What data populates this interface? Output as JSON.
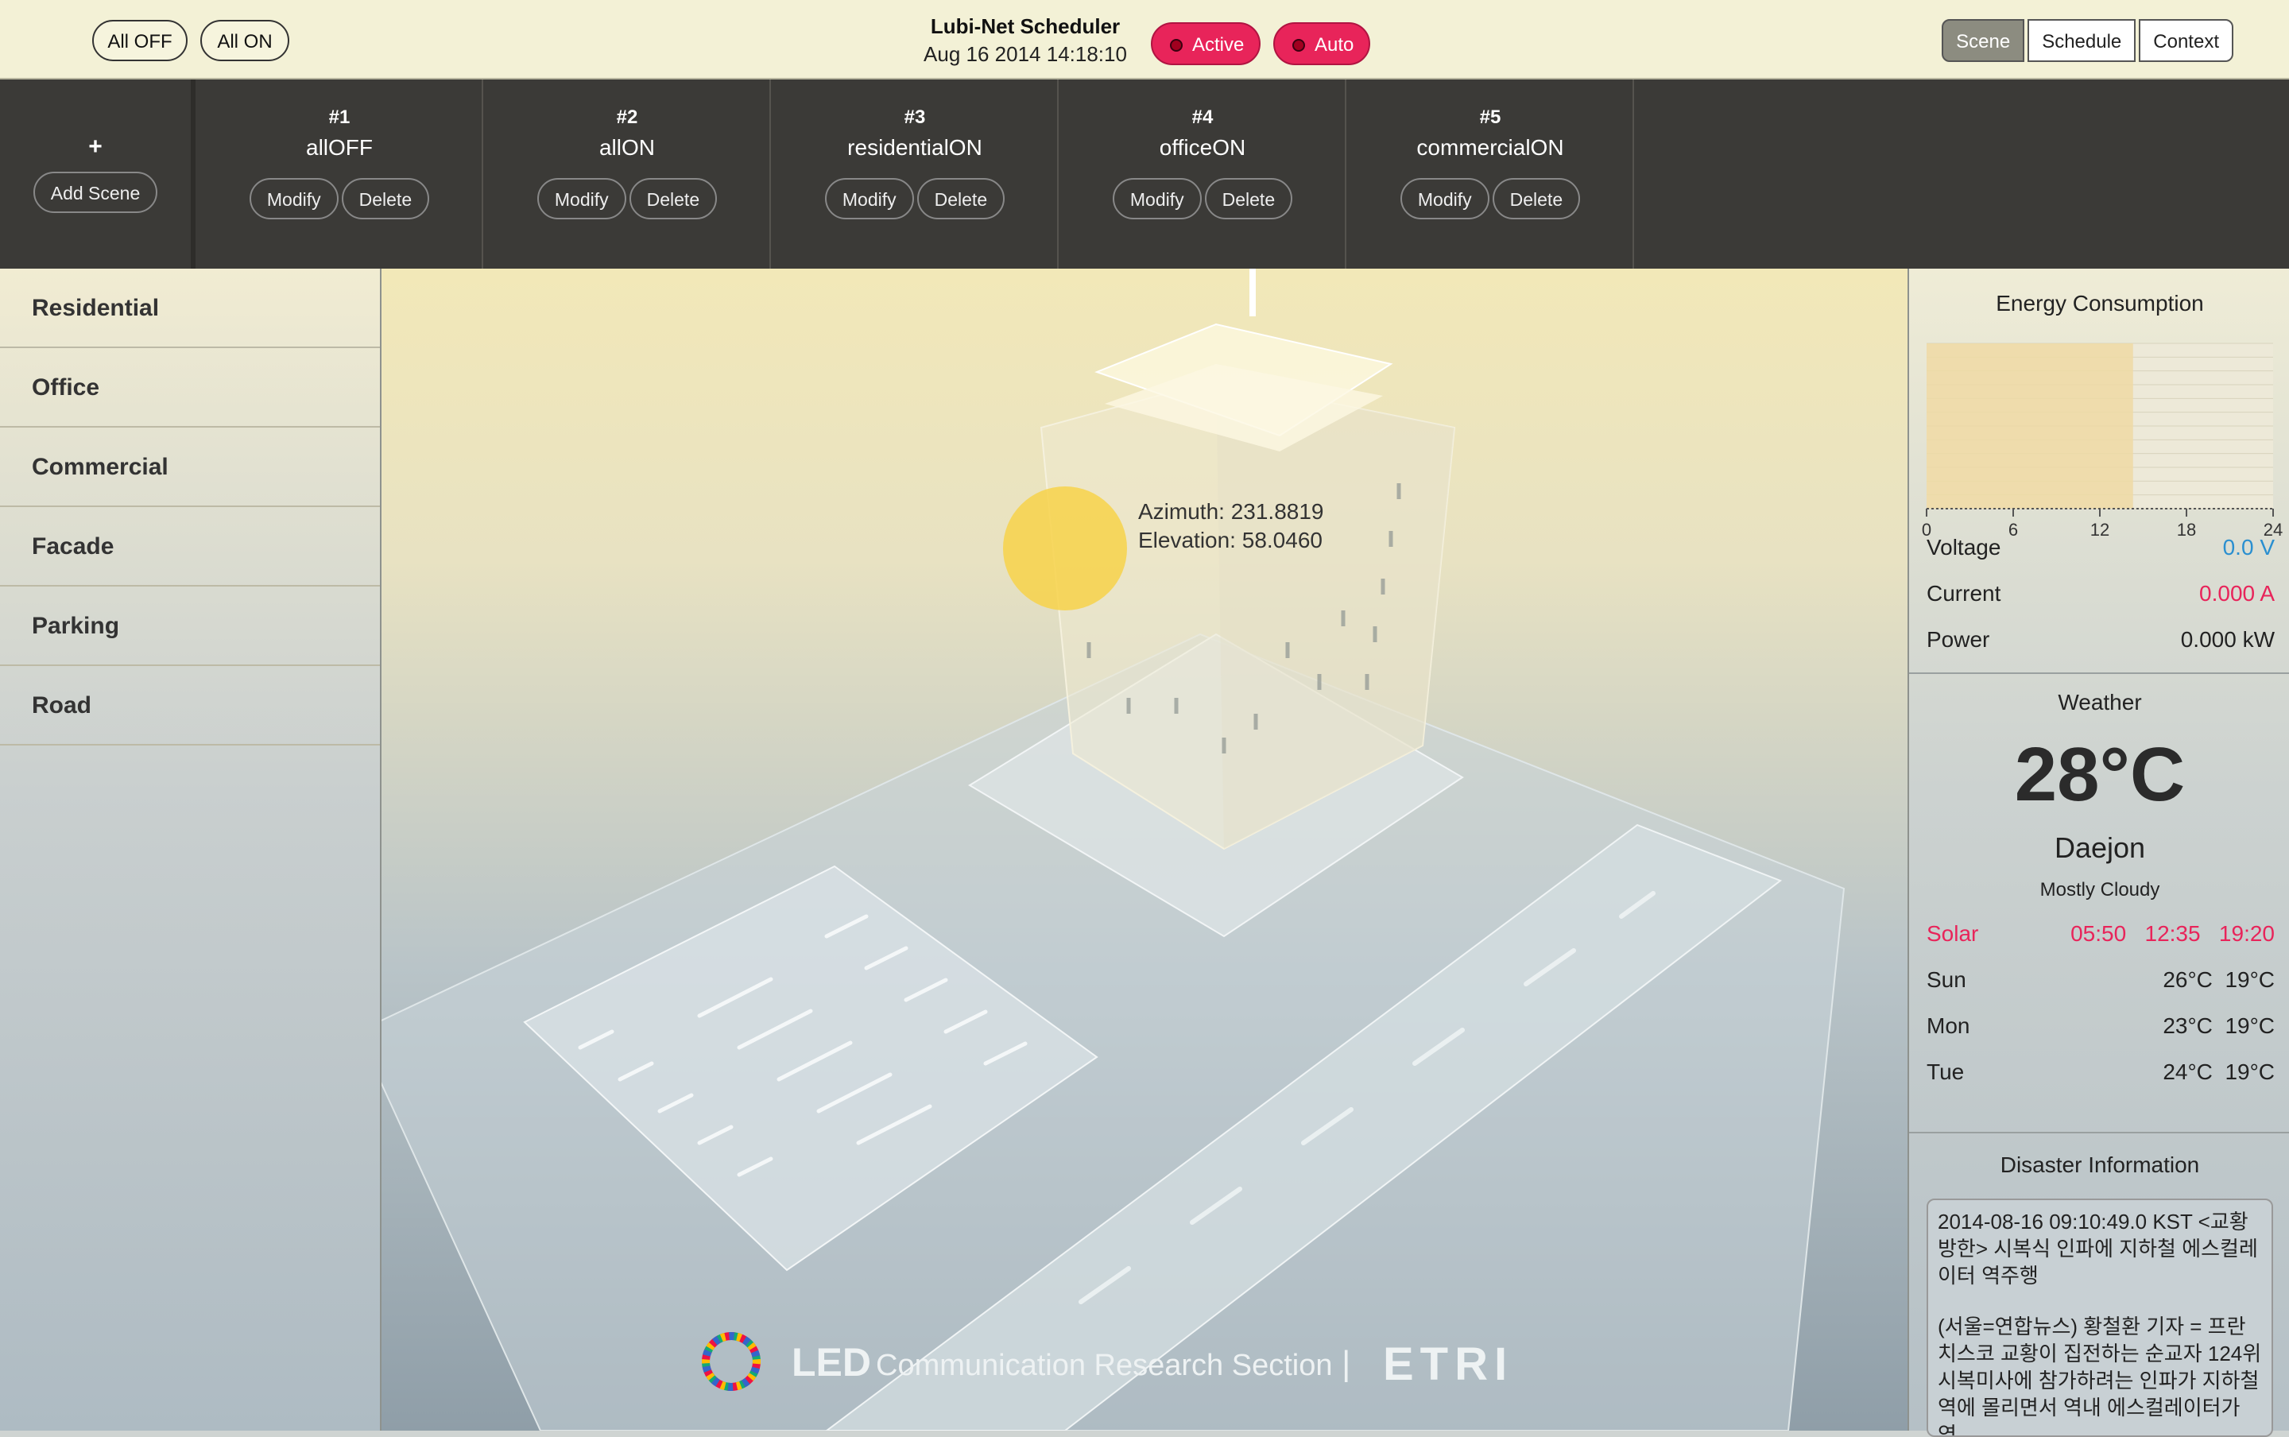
{
  "topbar": {
    "all_off": "All OFF",
    "all_on": "All ON",
    "app_title": "Lubi-Net Scheduler",
    "datetime": "Aug 16 2014 14:18:10",
    "status_active": "Active",
    "status_auto": "Auto",
    "tabs": [
      "Scene",
      "Schedule",
      "Context"
    ]
  },
  "scenes": {
    "add_plus": "+",
    "add_label": "Add Scene",
    "modify_label": "Modify",
    "delete_label": "Delete",
    "items": [
      {
        "num": "#1",
        "name": "allOFF"
      },
      {
        "num": "#2",
        "name": "allON"
      },
      {
        "num": "#3",
        "name": "residentialON"
      },
      {
        "num": "#4",
        "name": "officeON"
      },
      {
        "num": "#5",
        "name": "commercialON"
      }
    ]
  },
  "sidebar": {
    "items": [
      "Residential",
      "Office",
      "Commercial",
      "Facade",
      "Parking",
      "Road"
    ]
  },
  "view": {
    "azimuth": "Azimuth: 231.8819",
    "elevation": "Elevation: 58.0460",
    "footer_led": "LED",
    "footer_section": "Communication Research Section",
    "footer_sep": "|",
    "footer_org": "ETRI"
  },
  "energy": {
    "title": "Energy Consumption",
    "x_ticks": [
      "0",
      "6",
      "12",
      "18",
      "24"
    ],
    "voltage_label": "Voltage",
    "voltage_value": "0.0 V",
    "current_label": "Current",
    "current_value": "0.000 A",
    "power_label": "Power",
    "power_value": "0.000 kW",
    "voltage_color": "#2a8fd0",
    "current_color": "#e8245a"
  },
  "chart_data": {
    "type": "bar",
    "x": [
      0,
      14.3
    ],
    "xlim": [
      0,
      24
    ],
    "x_ticks": [
      "0",
      "6",
      "12",
      "18",
      "24"
    ],
    "highlighted_range": [
      0,
      14.3
    ],
    "grid": true
  },
  "weather": {
    "title": "Weather",
    "temp": "28°C",
    "city": "Daejon",
    "condition": "Mostly Cloudy",
    "solar_label": "Solar",
    "solar_times": [
      "05:50",
      "12:35",
      "19:20"
    ],
    "forecast": [
      {
        "day": "Sun",
        "high": "26°C",
        "low": "19°C"
      },
      {
        "day": "Mon",
        "high": "23°C",
        "low": "19°C"
      },
      {
        "day": "Tue",
        "high": "24°C",
        "low": "19°C"
      }
    ],
    "solar_color": "#e8245a"
  },
  "disaster": {
    "title": "Disaster Information",
    "p1": "2014-08-16 09:10:49.0 KST <교황방한> 시복식 인파에 지하철 에스컬레이터 역주행",
    "p2": "(서울=연합뉴스) 황철환 기자 = 프란치스코 교황이 집전하는 순교자 124위 시복미사에 참가하려는 인파가 지하철역에 몰리면서 역내 에스컬레이터가 역"
  },
  "colors": {
    "accent": "#e8245a",
    "scenebar": "#3b3a37",
    "topbar": "#f3f1d6"
  }
}
